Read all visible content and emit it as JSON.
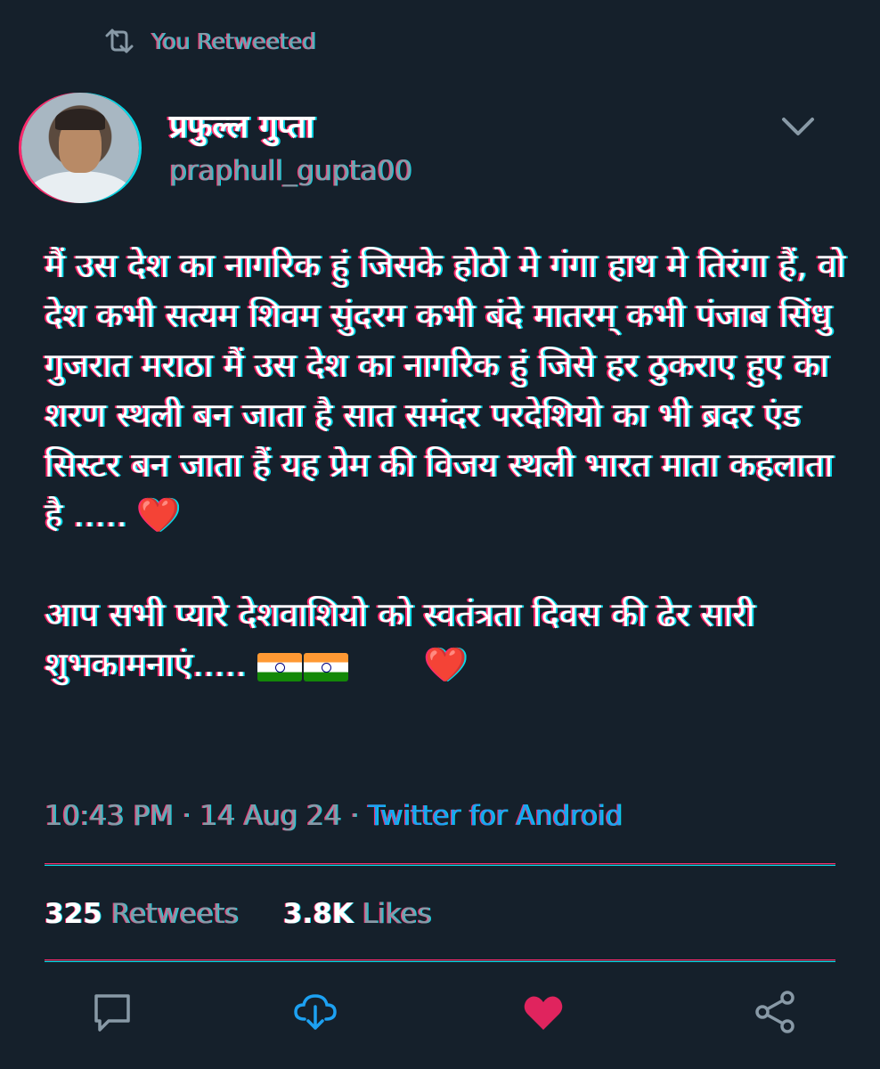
{
  "retweet_header": {
    "label": "You Retweeted",
    "icon": "retweet-icon"
  },
  "author": {
    "display_name": "प्रफुल्ल गुप्ता",
    "handle": "praphull_gupta00",
    "avatar": "avatar-photo"
  },
  "tweet": {
    "paragraph1": "मैं उस देश का नागरिक हुं जिसके होठो मे गंगा हाथ मे तिरंगा हैं, वो देश कभी सत्यम शिवम सुंदरम कभी बंदे मातरम् कभी पंजाब सिंधु गुजरात मराठा मैं उस देश का नागरिक हुं जिसे हर ठुकराए हुए का शरण स्थली बन जाता है  सात समंदर परदेशियो का भी ब्रदर एंड सिस्टर बन जाता हैं यह प्रेम की विजय स्थली भारत माता कहलाता है  .....",
    "paragraph2": "आप सभी प्यारे देशवाशियो को स्वतंत्रता दिवस की ढेर सारी शुभकामनाएं.....",
    "emoji_heart": "❤️"
  },
  "meta": {
    "time": "10:43 PM",
    "separator": "·",
    "date": "14 Aug 24",
    "source": "Twitter for Android"
  },
  "stats": {
    "retweets_count": "325",
    "retweets_label": "Retweets",
    "likes_count": "3.8K",
    "likes_label": "Likes"
  },
  "colors": {
    "background": "#15202b",
    "secondary_text": "#8899a6",
    "accent": "#1da1f2",
    "like": "#e0245e"
  },
  "actions": [
    "reply-icon",
    "retweet-icon",
    "like-icon",
    "share-icon"
  ]
}
